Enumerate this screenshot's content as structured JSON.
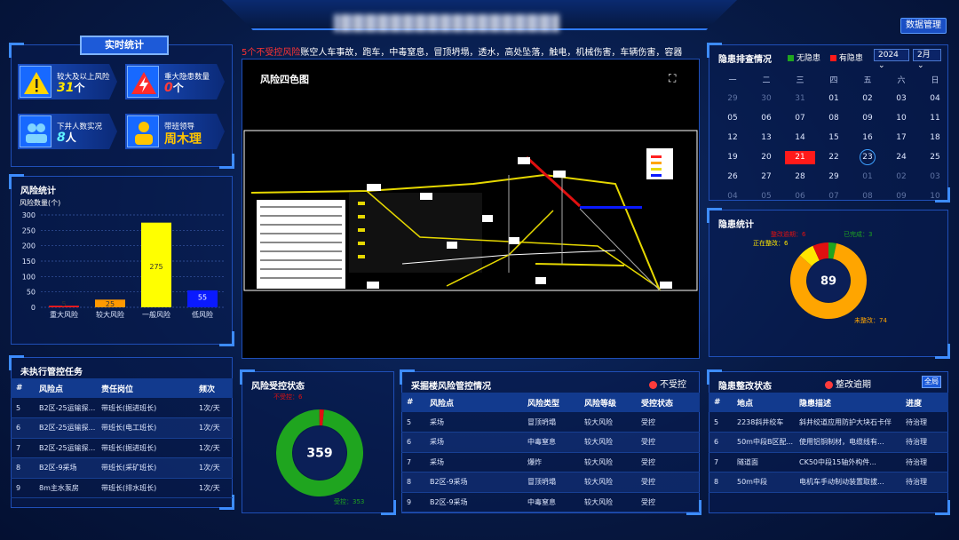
{
  "header": {
    "data_mgmt": "数据管理"
  },
  "realtime": {
    "tag": "实时统计",
    "items": [
      {
        "label": "较大及以上风险",
        "value": "31",
        "unit": "个"
      },
      {
        "label": "重大隐患数量",
        "value": "0",
        "unit": "个"
      },
      {
        "label": "下井人数实况",
        "value": "8",
        "unit": "人"
      },
      {
        "label": "带班领导",
        "value": "周木理",
        "unit": ""
      }
    ]
  },
  "marquee": {
    "red_text": "5个不受控风险",
    "text": "账空人车事故，跑车，中毒窒息，冒顶坍塌，透水，高处坠落，触电，机械伤害，车辆伤害，容器"
  },
  "map": {
    "title": "风险四色图"
  },
  "risk_stats": {
    "title": "风险统计",
    "chart_data": {
      "type": "bar",
      "ylabel": "风险数量(个)",
      "ylim": [
        0,
        300
      ],
      "yticks": [
        0,
        50,
        100,
        150,
        200,
        250,
        300
      ],
      "categories": [
        "重大风险",
        "较大风险",
        "一般风险",
        "低风险"
      ],
      "values": [
        5,
        25,
        275,
        55
      ],
      "colors": [
        "#ff1a1a",
        "#ff9900",
        "#ffff00",
        "#0a1aff"
      ]
    }
  },
  "pending_tasks": {
    "title": "未执行管控任务",
    "columns": [
      "#",
      "风险点",
      "责任岗位",
      "频次"
    ],
    "rows": [
      [
        "5",
        "B2区-25运输探...",
        "带班长(掘进班长)",
        "1次/天"
      ],
      [
        "6",
        "B2区-25运输探...",
        "带班长(电工班长)",
        "1次/天"
      ],
      [
        "7",
        "B2区-25运输探...",
        "带班长(掘进班长)",
        "1次/天"
      ],
      [
        "8",
        "B2区-9采场",
        "带班长(采矿班长)",
        "1次/天"
      ],
      [
        "9",
        "8m主水泵房",
        "带班长(排水班长)",
        "1次/天"
      ]
    ]
  },
  "risk_control": {
    "title": "风险受控状态",
    "chart_data": {
      "type": "pie",
      "total": "359",
      "slices": [
        {
          "label": "不受控",
          "value": 6,
          "color": "#e01010"
        },
        {
          "label": "受控",
          "value": 353,
          "color": "#1fa51f"
        }
      ]
    },
    "label_uncontrolled": "不受控：6",
    "label_controlled": "受控：353"
  },
  "stope_risk": {
    "title": "采掘楼风险管控情况",
    "flag": "不受控",
    "columns": [
      "#",
      "风险点",
      "风险类型",
      "风险等级",
      "受控状态"
    ],
    "rows": [
      [
        "5",
        "采场",
        "冒顶坍塌",
        "较大风险",
        "受控"
      ],
      [
        "6",
        "采场",
        "中毒窒息",
        "较大风险",
        "受控"
      ],
      [
        "7",
        "采场",
        "爆炸",
        "较大风险",
        "受控"
      ],
      [
        "8",
        "B2区-9采场",
        "冒顶坍塌",
        "较大风险",
        "受控"
      ],
      [
        "9",
        "B2区-9采场",
        "中毒窒息",
        "较大风险",
        "受控"
      ]
    ]
  },
  "hazard_calendar": {
    "title": "隐患排查情况",
    "legend_none": "无隐患",
    "legend_has": "有隐患",
    "colors": {
      "none": "#1fa51f",
      "has": "#ff1a1a"
    },
    "year": "2024",
    "month": "2月",
    "weekdays": [
      "一",
      "二",
      "三",
      "四",
      "五",
      "六",
      "日"
    ],
    "weeks": [
      [
        "29",
        "30",
        "31",
        "01",
        "02",
        "03",
        "04"
      ],
      [
        "05",
        "06",
        "07",
        "08",
        "09",
        "10",
        "11"
      ],
      [
        "12",
        "13",
        "14",
        "15",
        "16",
        "17",
        "18"
      ],
      [
        "19",
        "20",
        "21",
        "22",
        "23",
        "24",
        "25"
      ],
      [
        "26",
        "27",
        "28",
        "29",
        "01",
        "02",
        "03"
      ],
      [
        "04",
        "05",
        "06",
        "07",
        "08",
        "09",
        "10"
      ]
    ],
    "highlight_red": "21",
    "highlight_today": "23"
  },
  "hazard_stats": {
    "title": "隐患统计",
    "chart_data": {
      "type": "pie",
      "total": "89",
      "slices": [
        {
          "label": "未整改",
          "value": 74,
          "color": "#ffa500"
        },
        {
          "label": "正在整改",
          "value": 6,
          "color": "#ffe600"
        },
        {
          "label": "整改逾期",
          "value": 6,
          "color": "#e01010"
        },
        {
          "label": "已完成",
          "value": 3,
          "color": "#1fa51f"
        }
      ]
    },
    "labels": {
      "pending": "未整改：74",
      "in_progress": "正在整改：6",
      "overdue": "整改逾期：6",
      "done": "已完成：3"
    }
  },
  "rectify": {
    "title": "隐患整改状态",
    "flag": "整改逾期",
    "all": "全局",
    "columns": [
      "#",
      "地点",
      "隐患描述",
      "进度"
    ],
    "rows": [
      [
        "5",
        "2238斜井绞车",
        "斜井绞道应用防护大块石卡伴",
        "待治理"
      ],
      [
        "6",
        "50m中段B区配...",
        "使用铝铜制材，电缆线有...",
        "待治理"
      ],
      [
        "7",
        "隧道面",
        "CK50中段15轴外构件...",
        "待治理"
      ],
      [
        "8",
        "50m中段",
        "电机车手动制动装置取拔...",
        "待治理"
      ]
    ]
  }
}
